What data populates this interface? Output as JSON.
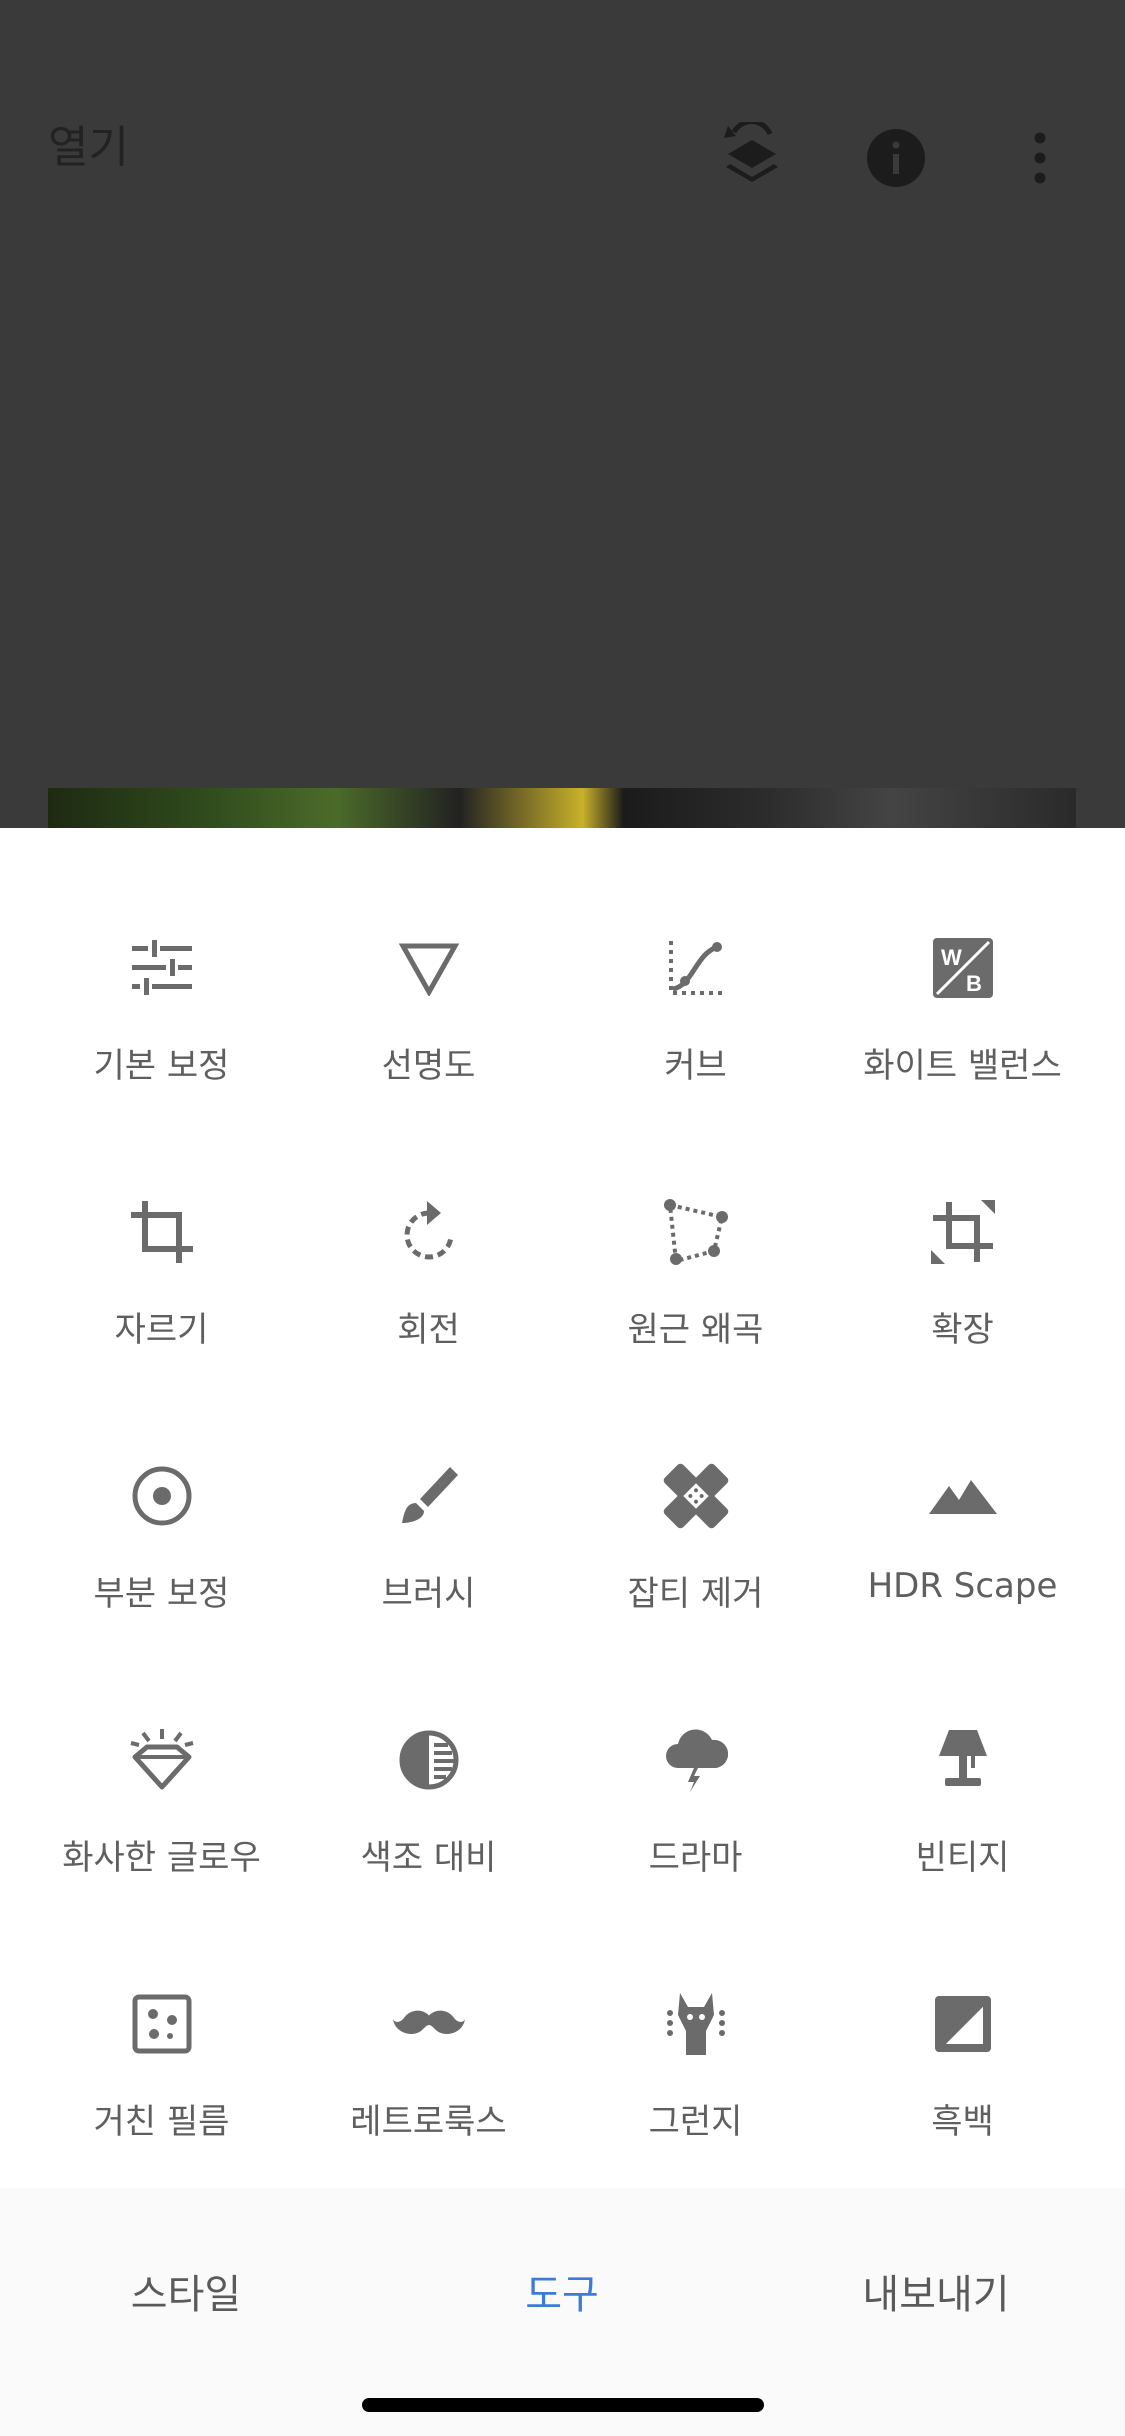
{
  "header": {
    "open_label": "열기",
    "icons": [
      "revert-layers-icon",
      "info-icon",
      "more-vert-icon"
    ]
  },
  "tools": [
    {
      "label": "기본 보정",
      "icon": "tune-icon"
    },
    {
      "label": "선명도",
      "icon": "details-triangle-icon"
    },
    {
      "label": "커브",
      "icon": "curves-icon"
    },
    {
      "label": "화이트 밸런스",
      "icon": "white-balance-icon"
    },
    {
      "label": "자르기",
      "icon": "crop-icon"
    },
    {
      "label": "회전",
      "icon": "rotate-icon"
    },
    {
      "label": "원근 왜곡",
      "icon": "perspective-icon"
    },
    {
      "label": "확장",
      "icon": "expand-icon"
    },
    {
      "label": "부분 보정",
      "icon": "selective-icon"
    },
    {
      "label": "브러시",
      "icon": "brush-icon"
    },
    {
      "label": "잡티 제거",
      "icon": "healing-icon"
    },
    {
      "label": "HDR Scape",
      "icon": "mountain-icon"
    },
    {
      "label": "화사한 글로우",
      "icon": "glamour-glow-icon"
    },
    {
      "label": "색조 대비",
      "icon": "tonal-contrast-icon"
    },
    {
      "label": "드라마",
      "icon": "drama-cloud-icon"
    },
    {
      "label": "빈티지",
      "icon": "vintage-lamp-icon"
    },
    {
      "label": "거친 필름",
      "icon": "grainy-film-icon"
    },
    {
      "label": "레트로룩스",
      "icon": "mustache-icon"
    },
    {
      "label": "그런지",
      "icon": "grunge-icon"
    },
    {
      "label": "흑백",
      "icon": "black-white-icon"
    }
  ],
  "bottom_tabs": [
    {
      "label": "스타일",
      "active": false
    },
    {
      "label": "도구",
      "active": true
    },
    {
      "label": "내보내기",
      "active": false
    }
  ],
  "colors": {
    "accent": "#3d7bd6",
    "icon": "#6b6b6b",
    "overlay": "#3a3a3a"
  }
}
